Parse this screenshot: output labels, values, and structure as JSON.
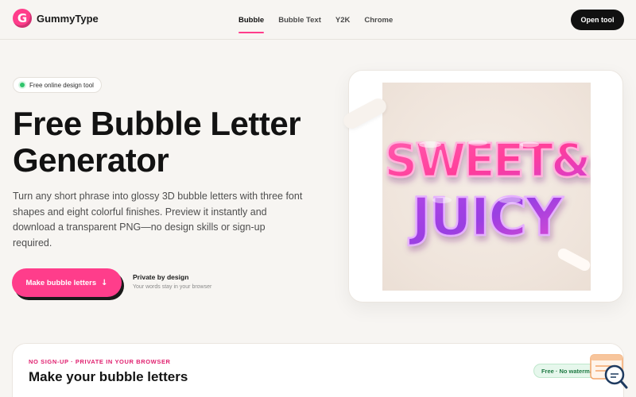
{
  "header": {
    "logo_letter": "G",
    "brand": "GummyType",
    "nav": [
      {
        "label": "Bubble",
        "active": true
      },
      {
        "label": "Bubble Text",
        "active": false
      },
      {
        "label": "Y2K",
        "active": false
      },
      {
        "label": "Chrome",
        "active": false
      }
    ],
    "open_tool_label": "Open tool"
  },
  "hero": {
    "badge": "Free online design tool",
    "title_line1": "Free Bubble Letter",
    "title_line2": "Generator",
    "description": "Turn any short phrase into glossy 3D bubble letters with three font shapes and eight colorful finishes. Preview it instantly and download a transparent PNG—no design skills or sign-up required.",
    "cta_label": "Make bubble letters",
    "cta_arrow": "↓",
    "privacy_title": "Private by design",
    "privacy_sub": "Your words stay in your browser"
  },
  "preview": {
    "line1": "SWEET&",
    "line2": "JUICY",
    "colors": {
      "pink": "#ff3d9a",
      "magenta": "#d13fd6",
      "purple": "#8a3ee0"
    }
  },
  "section": {
    "eyebrow": "NO SIGN-UP · PRIVATE IN YOUR BROWSER",
    "title": "Make your bubble letters",
    "free_badge": "Free · No watermark"
  },
  "icons": {
    "cta": "arrow-down-icon",
    "badge": "status-dot-icon",
    "helper": "search-chat-icon"
  },
  "colors": {
    "accent": "#ff3d8b",
    "dark": "#111111",
    "background": "#f7f5f2"
  }
}
